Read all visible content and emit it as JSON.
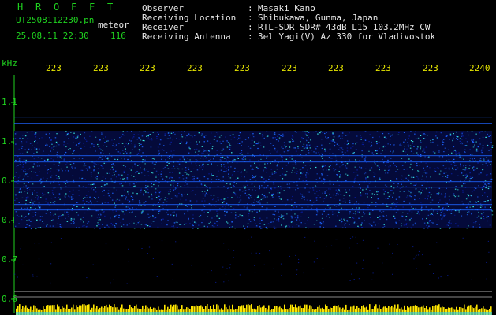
{
  "header": {
    "program_letters": [
      "H",
      "R",
      "O",
      "F",
      "F",
      "T"
    ],
    "file_name": "UT2508112230.pn",
    "file_suffix": "meteor",
    "date_time": "25.08.11 22:30",
    "count": "116",
    "fields": [
      {
        "label": "Observer",
        "value": "Masaki Kano"
      },
      {
        "label": "Receiving Location",
        "value": "Shibukawa, Gunma, Japan"
      },
      {
        "label": "Receiver",
        "value": "RTL-SDR SDR# 43dB L15 103.2MHz CW"
      },
      {
        "label": "Receiving Antenna",
        "value": "3el Yagi(V) Az 330 for Vladivostok"
      }
    ],
    "separator": ":"
  },
  "axis": {
    "unit": "kHz",
    "y_ticks": [
      "1.1",
      "1.0",
      "0.9",
      "0.8",
      "0.7",
      "0.6"
    ],
    "x_ticks": [
      "223",
      "223",
      "223",
      "223",
      "223",
      "223",
      "223",
      "223",
      "223",
      "2240"
    ]
  },
  "colors": {
    "background": "#000000",
    "axis_text_green": "#1fd11f",
    "header_white": "#e8e8e8",
    "time_labels_yellow": "#e6e600",
    "spectrum_low": "#0a1fa8",
    "spectrum_mid": "#1e64ff",
    "spectrum_high": "#3cf0e6",
    "signal_bar_yellow": "#ffe600",
    "signal_bar_cyan": "#22d4ff"
  }
}
